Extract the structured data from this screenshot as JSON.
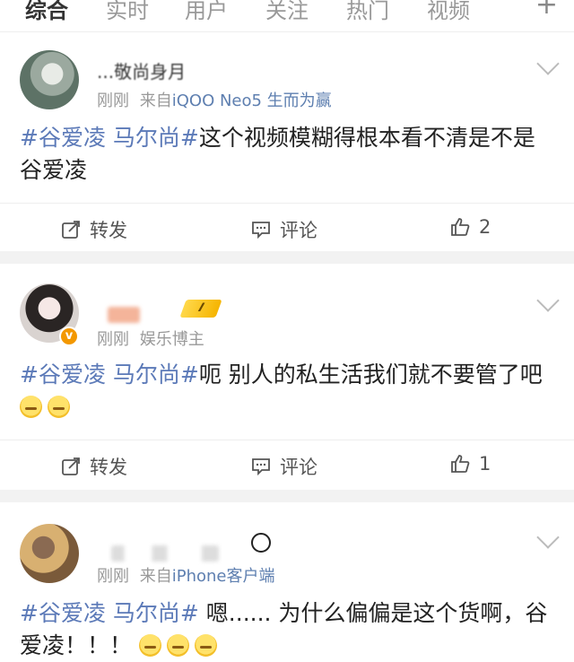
{
  "tabs": [
    "综合",
    "实时",
    "用户",
    "关注",
    "热门",
    "视频"
  ],
  "tab_plus": "+",
  "posts": [
    {
      "name": "...敬尚身月",
      "time": "刚刚",
      "source_prefix": "来自",
      "source": "iQOO Neo5 生而为赢",
      "hashtag": "#谷爱凌 马尔尚#",
      "text": "这个视频模糊得根本看不清是不是谷爱凌",
      "repost_label": "转发",
      "comment_label": "评论",
      "like_count": "2"
    },
    {
      "rank_badge": "I",
      "time": "刚刚",
      "identity": "娱乐博主",
      "verified_badge": "v",
      "hashtag": "#谷爱凌 马尔尚#",
      "text": "呃 别人的私生活我们就不要管了吧",
      "repost_label": "转发",
      "comment_label": "评论",
      "like_count": "1"
    },
    {
      "time": "刚刚",
      "source_prefix": "来自",
      "source": "iPhone客户端",
      "hashtag": "#谷爱凌 马尔尚#",
      "text": "嗯...... 为什么偏偏是这个货啊，谷爱凌！！！"
    }
  ]
}
